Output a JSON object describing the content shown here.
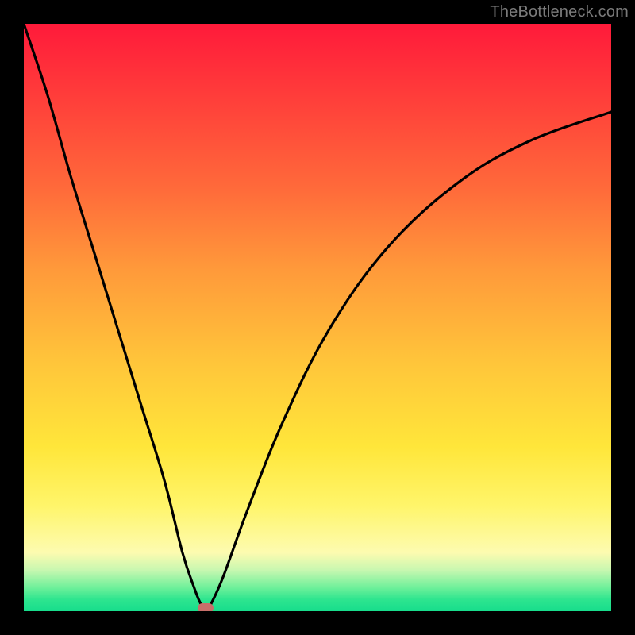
{
  "watermark": "TheBottleneck.com",
  "chart_data": {
    "type": "line",
    "title": "",
    "xlabel": "",
    "ylabel": "",
    "xlim": [
      0,
      100
    ],
    "ylim": [
      0,
      100
    ],
    "grid": false,
    "legend": false,
    "comment": "V-shaped bottleneck curve over vertical red→yellow→green gradient. Values are bottleneck% (y) vs component position (x), estimated from pixels; the minimum sits at x≈31 with y≈0.",
    "series": [
      {
        "name": "bottleneck-curve",
        "x": [
          0,
          4,
          8,
          12,
          16,
          20,
          24,
          27,
          29,
          30,
          31,
          32,
          34,
          38,
          44,
          52,
          62,
          74,
          86,
          100
        ],
        "values": [
          100,
          88,
          74,
          61,
          48,
          35,
          22,
          10,
          4,
          1.5,
          0,
          1.5,
          6,
          17,
          32,
          48,
          62,
          73,
          80,
          85
        ]
      }
    ],
    "marker": {
      "x": 31,
      "y": 0.5,
      "color": "#c86f6a"
    },
    "gradient_stops": [
      {
        "pos": 0,
        "color": "#ff1a3a"
      },
      {
        "pos": 50,
        "color": "#ffc63a"
      },
      {
        "pos": 90,
        "color": "#fdfbb0"
      },
      {
        "pos": 100,
        "color": "#17dd8c"
      }
    ]
  }
}
